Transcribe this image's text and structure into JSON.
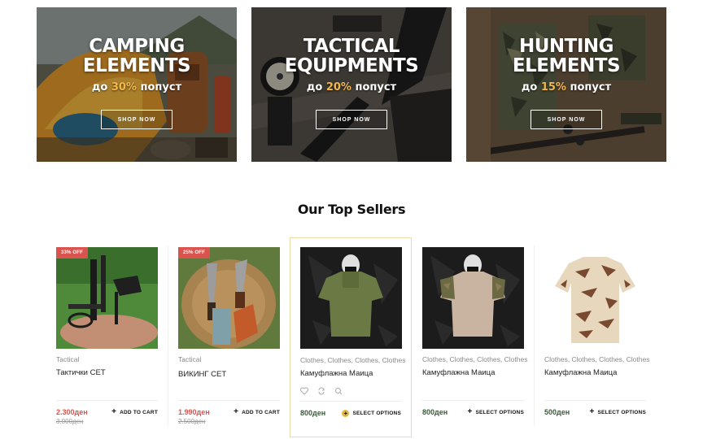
{
  "banners": [
    {
      "line1": "CAMPING",
      "line2": "ELEMENTS",
      "promo_prefix": "до",
      "percent": "30%",
      "promo_suffix": "попуст",
      "button": "SHOP NOW"
    },
    {
      "line1": "TACTICAL",
      "line2": "EQUIPMENTS",
      "promo_prefix": "до",
      "percent": "20%",
      "promo_suffix": "попуст",
      "button": "SHOP NOW"
    },
    {
      "line1": "HUNTING",
      "line2": "ELEMENTS",
      "promo_prefix": "до",
      "percent": "15%",
      "promo_suffix": "попуст",
      "button": "SHOP NOW"
    }
  ],
  "section_title": "Our Top Sellers",
  "products": [
    {
      "badge": "33% OFF",
      "category": "Tactical",
      "name": "Тактички СЕТ",
      "price": "2.300ден",
      "old_price": "3.000ден",
      "action": "ADD TO CART"
    },
    {
      "badge": "25% OFF",
      "category": "Tactical",
      "name": "ВИКИНГ СЕТ",
      "price": "1.990ден",
      "old_price": "2.500ден",
      "action": "ADD TO CART"
    },
    {
      "category": "Clothes, Clothes, Clothes, Clothes",
      "name": "Камуфлажна Маица",
      "price": "800ден",
      "action": "SELECT OPTIONS"
    },
    {
      "category": "Clothes, Clothes, Clothes, Clothes",
      "name": "Камуфлажна Маица",
      "price": "800ден",
      "action": "SELECT OPTIONS"
    },
    {
      "category": "Clothes, Clothes, Clothes, Clothes",
      "name": "Камуфлажна Маица",
      "price": "500ден",
      "action": "SELECT OPTIONS"
    }
  ],
  "icons": {
    "wishlist": "heart-icon",
    "compare": "refresh-icon",
    "quickview": "search-icon"
  },
  "colors": {
    "sale_badge": "#d9534f",
    "promo_percent": "#f3b84a",
    "active_border": "#e8dcaa",
    "regular_price": "#3b5a3b"
  }
}
